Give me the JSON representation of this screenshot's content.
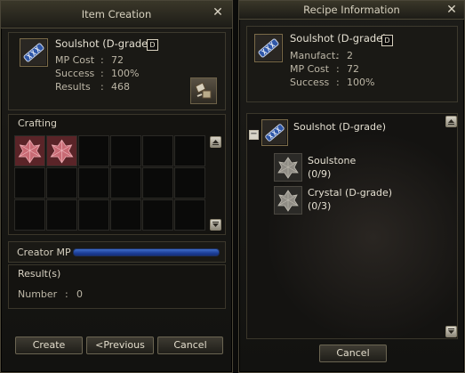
{
  "item_creation": {
    "title": "Item Creation",
    "item": {
      "name": "Soulshot (D-grade)",
      "grade_badge": "D",
      "mp_cost_label": "MP Cost",
      "mp_cost": "72",
      "success_label": "Success",
      "success": "100%",
      "results_label": "Results",
      "results": "468"
    },
    "crafting_label": "Crafting",
    "crafting_slots_filled": 2,
    "creator_mp_label": "Creator MP",
    "creator_mp_fraction": 1.0,
    "results_header": "Result(s)",
    "number_label": "Number",
    "number_value": "0",
    "buttons": {
      "create": "Create",
      "previous": "<Previous",
      "cancel": "Cancel"
    }
  },
  "recipe_information": {
    "title": "Recipe Information",
    "item": {
      "name": "Soulshot (D-grade)",
      "grade_badge": "D",
      "manufact_label": "Manufact.",
      "manufact": "2",
      "mp_cost_label": "MP Cost",
      "mp_cost": "72",
      "success_label": "Success",
      "success": "100%"
    },
    "tree": {
      "toggle": "−",
      "root_name": "Soulshot (D-grade)",
      "ingredients": [
        {
          "name": "Soulstone",
          "count": "(0/9)"
        },
        {
          "name": "Crystal (D-grade)",
          "count": "(0/3)"
        }
      ]
    },
    "cancel_button": "Cancel"
  },
  "colon": ":",
  "close_glyph": "✕",
  "icons": {
    "soulshot": "soulshot-icon",
    "crystal": "crystal-icon",
    "scroll_up": "scroll-up-icon",
    "scroll_down": "scroll-down-icon",
    "recipe_book": "recipe-book-icon"
  }
}
